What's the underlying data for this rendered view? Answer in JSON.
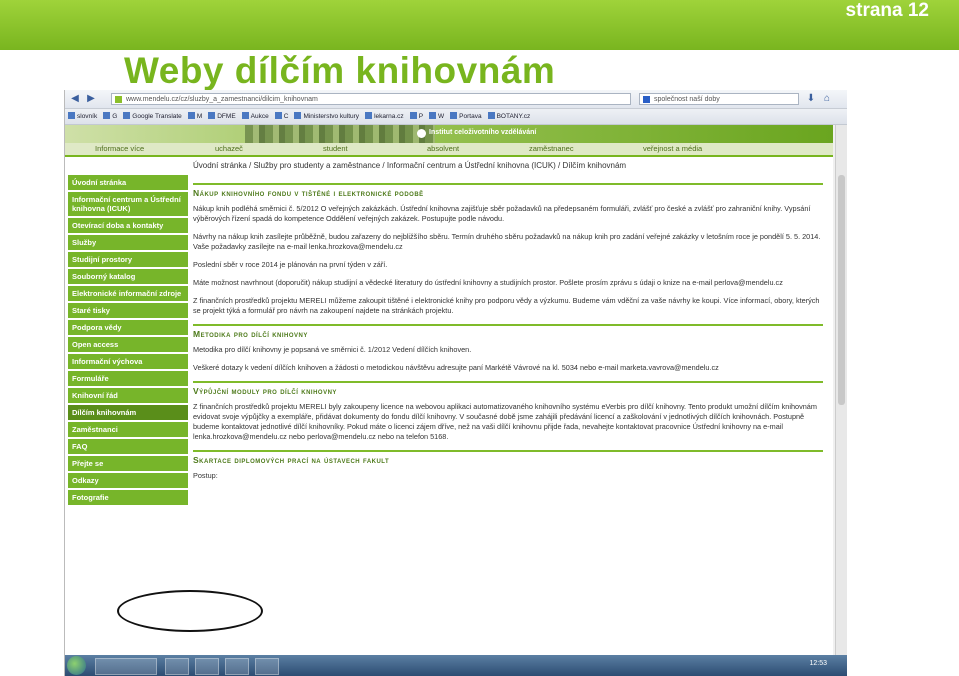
{
  "slide": {
    "page_number": "strana 12",
    "title": "Weby dílčím knihovnám"
  },
  "browser": {
    "url": "www.mendelu.cz/cz/sluzby_a_zamestnanci/dilcim_knihovnam",
    "search_placeholder": "společnost naší doby",
    "bookmarks": [
      "slovník",
      "G",
      "Google Translate",
      "M",
      "DFME",
      "Aukce",
      "C",
      "Ministerstvo kultury",
      "lekarna.cz",
      "P",
      "W",
      "Portava",
      "BOTANY.cz"
    ]
  },
  "site": {
    "banner_text": "Institut celoživotního vzdělávání",
    "topnav": [
      "uchazeč",
      "student",
      "absolvent",
      "zaměstnanec",
      "veřejnost a média"
    ],
    "topnav_left": "Informace více",
    "breadcrumb": "Úvodní stránka / Služby pro studenty a zaměstnance / Informační centrum a Ústřední knihovna (ICUK) / Dílčím knihovnám",
    "sidebar": [
      "Úvodní stránka",
      "Informační centrum a Ústřední knihovna (ICUK)",
      "Otevírací doba a kontakty",
      "Služby",
      "Studijní prostory",
      "Souborný katalog",
      "Elektronické informační zdroje",
      "Staré tisky",
      "Podpora vědy",
      "Open access",
      "Informační výchova",
      "Formuláře",
      "Knihovní řád",
      "Dílčím knihovnám",
      "Zaměstnanci",
      "FAQ",
      "Přejte se",
      "Odkazy",
      "Fotografie"
    ],
    "active_item": "Dílčím knihovnám",
    "sections": [
      {
        "heading": "Nákup knihovního fondu v tištěné i elektronické podobě",
        "paragraphs": [
          "Nákup knih podléhá směrnici č. 5/2012 O veřejných zakázkách. Ústřední knihovna zajišťuje sběr požadavků na předepsaném formuláři, zvlášť pro české a zvlášť pro zahraniční knihy. Vypsání výběrových řízení spadá do kompetence Oddělení veřejných zakázek. Postupujte podle návodu.",
          "Návrhy na nákup knih zasílejte průběžně, budou zařazeny do nejbližšího sběru. Termín druhého sběru požadavků na nákup knih pro zadání veřejné zakázky v letošním roce je pondělí 5. 5. 2014. Vaše požadavky zasílejte na e-mail lenka.hrozkova@mendelu.cz",
          "Poslední sběr v roce 2014 je plánován na první týden v září.",
          "Máte možnost navrhnout (doporučit) nákup studijní a vědecké literatury do ústřední knihovny a studijních prostor. Pošlete prosím zprávu s údaji o knize na e-mail perlova@mendelu.cz",
          "Z finančních prostředků projektu MERELI můžeme zakoupit tištěné i elektronické knihy pro podporu vědy a výzkumu. Budeme vám vděční za vaše návrhy ke koupi. Více informací, obory, kterých se projekt týká a formulář pro návrh na zakoupení najdete na stránkách projektu."
        ]
      },
      {
        "heading": "Metodika pro dílčí knihovny",
        "paragraphs": [
          "Metodika pro dílčí knihovny je popsaná ve směrnici č. 1/2012 Vedení dílčích knihoven.",
          "Veškeré dotazy k vedení dílčích knihoven a žádosti o metodickou návštěvu adresujte paní Markétě Vávrové na kl. 5034 nebo e-mail marketa.vavrova@mendelu.cz"
        ]
      },
      {
        "heading": "Výpůjční moduly pro dílčí knihovny",
        "paragraphs": [
          "Z finančních prostředků projektu MERELI byly zakoupeny licence na webovou aplikaci automatizovaného knihovního systému eVerbis pro dílčí knihovny. Tento produkt umožní dílčím knihovnám evidovat svoje výpůjčky a exempláře, přidávat dokumenty do fondu dílčí knihovny. V současné době jsme zahájili předávání licencí a zaškolování v jednotlivých dílčích knihovnách. Postupně budeme kontaktovat jednotlivé dílčí knihovníky. Pokud máte o licenci zájem dříve, než na vaši dílčí knihovnu přijde řada, nevahejte kontaktovat pracovnice Ústřední knihovny na e-mail lenka.hrozkova@mendelu.cz nebo perlova@mendelu.cz nebo na telefon 5168."
        ]
      },
      {
        "heading": "Skartace diplomových prací na ústavech fakult",
        "paragraphs": [
          "Postup:"
        ]
      }
    ]
  },
  "taskbar": {
    "clock": "12:53"
  }
}
